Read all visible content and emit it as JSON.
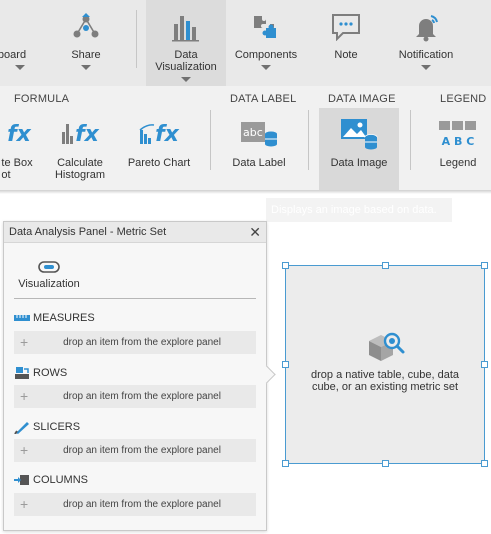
{
  "ribbon": {
    "top_buttons": [
      {
        "label": "board",
        "icon": "dashboard-icon"
      },
      {
        "label": "Share",
        "icon": "share-icon"
      },
      {
        "label": "Data\nVisualization",
        "icon": "data-visualization-icon"
      },
      {
        "label": "Components",
        "icon": "components-icon"
      },
      {
        "label": "Note",
        "icon": "note-icon"
      },
      {
        "label": "Notification",
        "icon": "notification-bell-icon"
      }
    ],
    "groups": {
      "formula": "FORMULA",
      "data_label": "DATA LABEL",
      "data_image": "DATA IMAGE",
      "legend": "LEGEND"
    },
    "sub_buttons": [
      {
        "label": "te Box\not",
        "icon": "box-plot-fx-icon"
      },
      {
        "label": "Calculate\nHistogram",
        "icon": "histogram-fx-icon"
      },
      {
        "label": "Pareto Chart",
        "icon": "pareto-fx-icon"
      },
      {
        "label": "Data Label",
        "icon": "data-label-icon"
      },
      {
        "label": "Data Image",
        "icon": "data-image-icon"
      },
      {
        "label": "Legend",
        "icon": "legend-icon",
        "letters": "A B C"
      }
    ],
    "tooltip": "Displays an image based on data."
  },
  "panel": {
    "title": "Data Analysis Panel - Metric Set",
    "close": "✕",
    "visualization_tab": "Visualization",
    "sections": [
      {
        "title": "MEASURES",
        "placeholder": "drop an item from the explore panel"
      },
      {
        "title": "ROWS",
        "placeholder": "drop an item from the explore panel"
      },
      {
        "title": "SLICERS",
        "placeholder": "drop an item from the explore panel"
      },
      {
        "title": "COLUMNS",
        "placeholder": "drop an item from the explore panel"
      }
    ]
  },
  "widget": {
    "text": "drop a native table, cube, data cube, or an existing metric set"
  },
  "colors": {
    "accent": "#2f8fd0",
    "selection": "#4a9bd1"
  }
}
